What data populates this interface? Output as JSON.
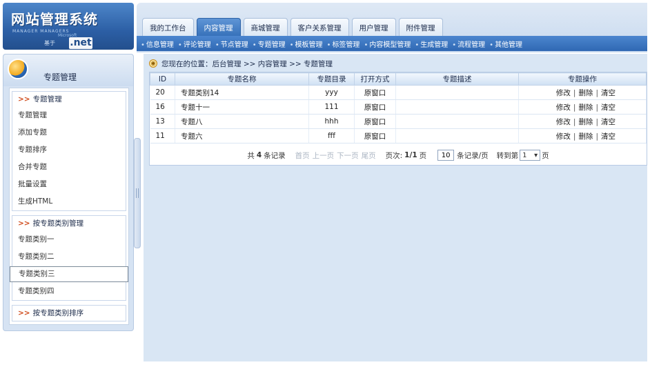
{
  "logo": {
    "title": "网站管理系统",
    "subtitle": "MANAGER MANAGERS",
    "powered": "基于",
    "brand": "Microsoft",
    "net": ".net"
  },
  "nav": {
    "tabs": [
      "我的工作台",
      "内容管理",
      "商城管理",
      "客户关系管理",
      "用户管理",
      "附件管理"
    ],
    "active_index": 1
  },
  "subnav": [
    "信息管理",
    "评论管理",
    "节点管理",
    "专题管理",
    "模板管理",
    "标签管理",
    "内容模型管理",
    "生成管理",
    "流程管理",
    "其他管理"
  ],
  "left": {
    "title": "专题管理",
    "groups": [
      {
        "title": "专题管理",
        "items": [
          "专题管理",
          "添加专题",
          "专题排序",
          "合并专题",
          "批量设置",
          "生成HTML"
        ]
      },
      {
        "title": "按专题类别管理",
        "items": [
          "专题类别一",
          "专题类别二",
          "专题类别三",
          "专题类别四"
        ]
      },
      {
        "title": "按专题类别排序",
        "items": []
      }
    ],
    "selected": "专题类别三"
  },
  "breadcrumb": {
    "prefix": "您现在的位置：",
    "path": "后台管理 >> 内容管理 >> 专题管理"
  },
  "table": {
    "headers": [
      "ID",
      "专题名称",
      "专题目录",
      "打开方式",
      "专题描述",
      "专题操作"
    ],
    "rows": [
      {
        "id": "20",
        "name": "专题类别14",
        "dir": "yyy",
        "open": "原窗口",
        "desc": ""
      },
      {
        "id": "16",
        "name": "专题十一",
        "dir": "111",
        "open": "原窗口",
        "desc": ""
      },
      {
        "id": "13",
        "name": "专题八",
        "dir": "hhh",
        "open": "原窗口",
        "desc": ""
      },
      {
        "id": "11",
        "name": "专题六",
        "dir": "fff",
        "open": "原窗口",
        "desc": ""
      }
    ],
    "ops": {
      "edit": "修改",
      "delete": "删除",
      "clear": "清空",
      "sep": "|"
    }
  },
  "pager": {
    "total_prefix": "共",
    "total": "4",
    "total_suffix": "条记录",
    "first": "首页",
    "prev": "上一页",
    "next": "下一页",
    "last": "尾页",
    "page_label": "页次:",
    "page_value": "1/1",
    "page_suffix": "页",
    "per_page": "10",
    "per_page_suffix": "条记录/页",
    "goto_prefix": "转到第",
    "goto_value": "1",
    "goto_suffix": "页"
  }
}
